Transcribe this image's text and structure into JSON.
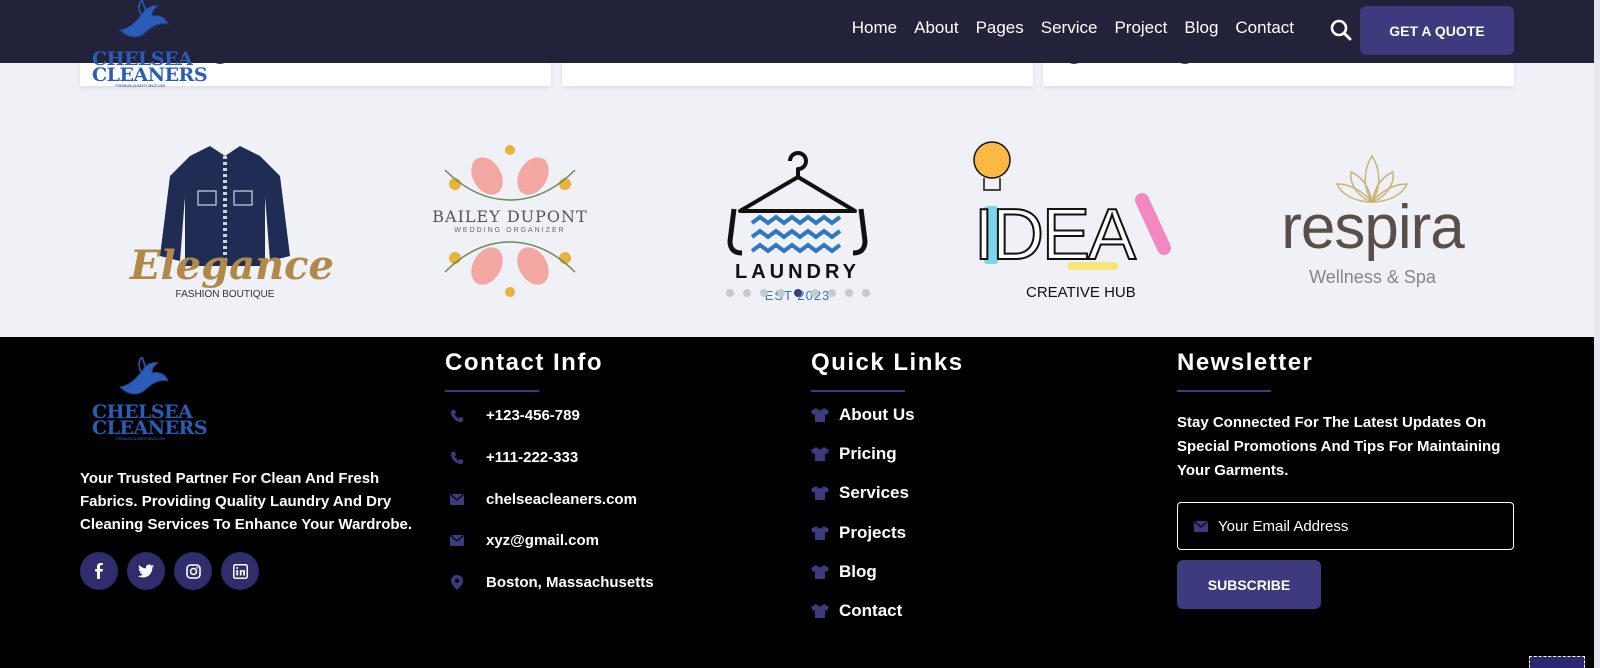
{
  "brand": {
    "name_line1": "CHELSEA",
    "name_line2": "CLEANERS",
    "tagline": "PREMIUM LAUNDRY SINCE 1999"
  },
  "nav": {
    "items": [
      "Home",
      "About",
      "Pages",
      "Service",
      "Project",
      "Blog",
      "Contact"
    ],
    "cta": "GET A QUOTE"
  },
  "partners": {
    "elegance": {
      "name": "Elegance",
      "sub": "FASHION BOUTIQUE"
    },
    "bailey": {
      "name": "BAILEY DUPONT",
      "sub": "WEDDING ORGANIZER"
    },
    "laundry": {
      "name": "LAUNDRY",
      "sub": "EST 2023"
    },
    "idea": {
      "name": "IDEA",
      "sub": "CREATIVE HUB"
    },
    "respira": {
      "name": "respira",
      "sub": "Wellness & Spa"
    },
    "carousel_active_index": 4
  },
  "footer": {
    "about": "Your Trusted Partner For Clean And Fresh Fabrics. Providing Quality Laundry And Dry Cleaning Services To Enhance Your Wardrobe.",
    "social": [
      "facebook-icon",
      "twitter-icon",
      "instagram-icon",
      "linkedin-icon"
    ],
    "contact": {
      "heading": "Contact Info",
      "phone1": "+123-456-789",
      "phone2": "+111-222-333",
      "email1": "chelseacleaners.com",
      "email2": "xyz@gmail.com",
      "location": "Boston, Massachusetts"
    },
    "quick_links": {
      "heading": "Quick Links",
      "items": [
        "About Us",
        "Pricing",
        "Services",
        "Projects",
        "Blog",
        "Contact"
      ]
    },
    "newsletter": {
      "heading": "Newsletter",
      "text": "Stay Connected For The Latest Updates On Special Promotions And Tips For Maintaining Your Garments.",
      "placeholder": "Your Email Address",
      "button": "SUBSCRIBE"
    }
  },
  "colors": {
    "header_bg": "#22223b",
    "accent": "#3d3a7e",
    "footer_bg": "#000000",
    "section_bg": "#f0f0f7"
  }
}
